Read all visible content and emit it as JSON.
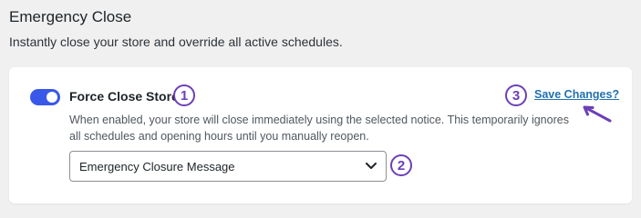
{
  "section": {
    "title": "Emergency Close",
    "description": "Instantly close your store and override all active schedules."
  },
  "setting": {
    "toggle_state": "on",
    "label": "Force Close Store",
    "help_text": "When enabled, your store will close immediately using the selected notice. This temporarily ignores all schedules and opening hours until you manually reopen."
  },
  "notice_select": {
    "selected": "Emergency Closure Message"
  },
  "save_link": {
    "label": "Save Changes?"
  },
  "annotations": [
    "1",
    "2",
    "3"
  ],
  "colors": {
    "toggle_on": "#3858e9",
    "link": "#2271b1",
    "annotation": "#6b3fb8",
    "background": "#f0f0f1"
  },
  "icons": {
    "select": "chevron-down-icon",
    "pointer": "arrow-icon"
  }
}
